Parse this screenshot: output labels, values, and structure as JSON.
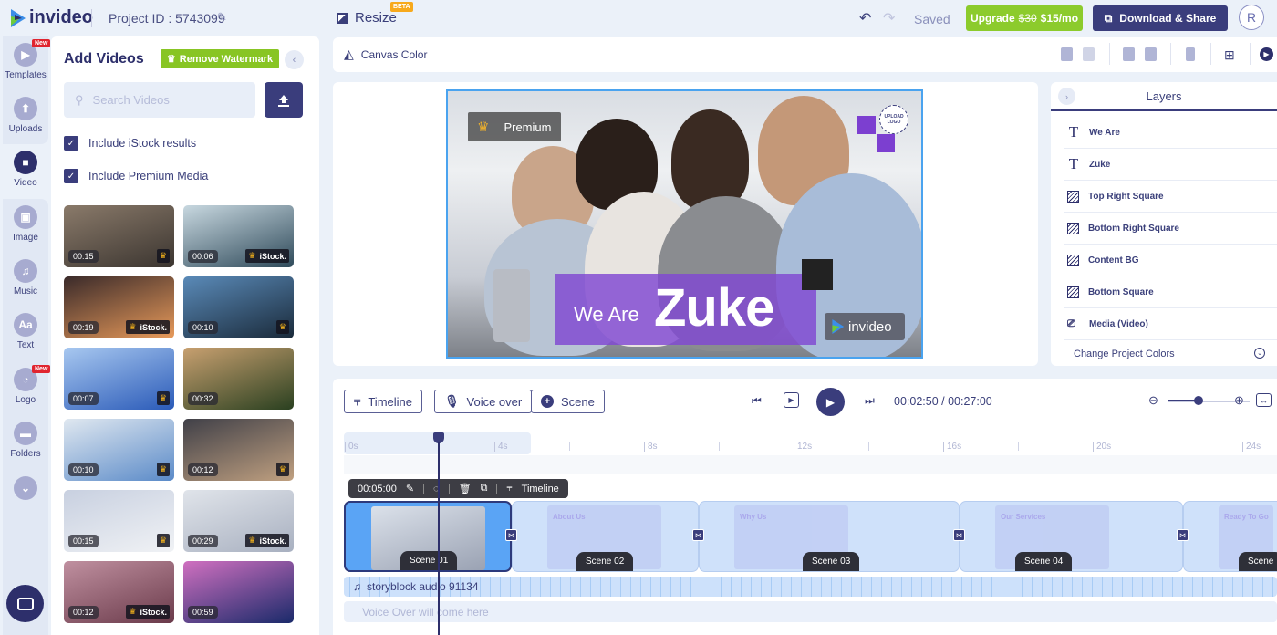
{
  "header": {
    "brand": "invideo",
    "project_id": "Project ID : 5743099",
    "resize_label": "Resize",
    "beta_badge": "BETA",
    "save_status": "Saved",
    "upgrade": {
      "label": "Upgrade",
      "old_price": "$30",
      "new_price": "$15/mo"
    },
    "download_share": "Download & Share",
    "avatar_initial": "R"
  },
  "rail": {
    "items": [
      {
        "label": "Templates",
        "icon": "template-icon",
        "badge": "New"
      },
      {
        "label": "Uploads",
        "icon": "upload-icon"
      },
      {
        "label": "Video",
        "icon": "video-camera-icon",
        "active": true
      },
      {
        "label": "Image",
        "icon": "image-icon"
      },
      {
        "label": "Music",
        "icon": "music-icon"
      },
      {
        "label": "Text",
        "icon": "text-icon",
        "glyph": "Aa"
      },
      {
        "label": "Logo",
        "icon": "logo-icon",
        "badge": "New"
      },
      {
        "label": "Folders",
        "icon": "folder-icon"
      }
    ]
  },
  "panel": {
    "title": "Add Videos",
    "remove_watermark": "Remove Watermark",
    "search_placeholder": "Search Videos",
    "include_istock": "Include iStock results",
    "include_premium": "Include Premium Media",
    "videos": [
      {
        "duration": "00:15",
        "source": "premium",
        "colors": [
          "#3b3530",
          "#8a7a6a"
        ]
      },
      {
        "duration": "00:06",
        "source": "iStock.",
        "colors": [
          "#2f4a5a",
          "#c8d8e0"
        ]
      },
      {
        "duration": "00:19",
        "source": "iStock.",
        "colors": [
          "#e89a5a",
          "#3a2a2a"
        ]
      },
      {
        "duration": "00:10",
        "source": "premium",
        "colors": [
          "#1a2a3a",
          "#5a8ab8"
        ]
      },
      {
        "duration": "00:07",
        "source": "premium",
        "colors": [
          "#2a5ab8",
          "#a8c8f0"
        ]
      },
      {
        "duration": "00:32",
        "source": "none",
        "colors": [
          "#2a4020",
          "#c8a070"
        ]
      },
      {
        "duration": "00:10",
        "source": "premium",
        "colors": [
          "#5a8ac8",
          "#e0e8f0"
        ]
      },
      {
        "duration": "00:12",
        "source": "premium",
        "colors": [
          "#c0a080",
          "#404048"
        ]
      },
      {
        "duration": "00:15",
        "source": "premium",
        "colors": [
          "#f0f2f5",
          "#c8d0e0"
        ]
      },
      {
        "duration": "00:29",
        "source": "iStock.",
        "colors": [
          "#a8b0c0",
          "#e0e4ea"
        ]
      },
      {
        "duration": "00:12",
        "source": "iStock.",
        "colors": [
          "#6a3a4a",
          "#c090a0"
        ]
      },
      {
        "duration": "00:59",
        "source": "none",
        "colors": [
          "#1a2a6a",
          "#d070c0"
        ]
      }
    ]
  },
  "canvas_toolbar": {
    "canvas_color": "Canvas Color"
  },
  "scene": {
    "premium_label": "Premium",
    "text_we_are": "We Are",
    "text_zuke": "Zuke",
    "watermark": "invideo",
    "upload_logo": "UPLOAD LOGO",
    "accent": "#7c3fd0"
  },
  "layers": {
    "title": "Layers",
    "items": [
      {
        "name": "We Are",
        "type": "text"
      },
      {
        "name": "Zuke",
        "type": "text"
      },
      {
        "name": "Top Right Square",
        "type": "shape"
      },
      {
        "name": "Bottom Right Square",
        "type": "shape"
      },
      {
        "name": "Content BG",
        "type": "shape"
      },
      {
        "name": "Bottom Square",
        "type": "shape"
      },
      {
        "name": "Media (Video)",
        "type": "media"
      }
    ],
    "change_colors": "Change Project Colors"
  },
  "timeline": {
    "btn_timeline": "Timeline",
    "btn_voiceover": "Voice over",
    "btn_scene": "Scene",
    "current_time": "00:02:50",
    "total_time": "00:27:00",
    "zoom_level": 0.38,
    "ruler": [
      "0s",
      "4s",
      "8s",
      "12s",
      "16s",
      "20s",
      "24s"
    ],
    "scene_toolbar": {
      "duration": "00:05:00",
      "timeline": "Timeline"
    },
    "scenes": [
      {
        "label": "Scene 01",
        "selected": true,
        "title": ""
      },
      {
        "label": "Scene 02",
        "title": "About Us"
      },
      {
        "label": "Scene 03",
        "title": "Why Us"
      },
      {
        "label": "Scene 04",
        "title": "Our Services"
      },
      {
        "label": "Scene",
        "title": "Ready To Go"
      }
    ],
    "audio_track": "storyblock audio 91134",
    "voiceover_placeholder": "Voice Over will come here"
  }
}
